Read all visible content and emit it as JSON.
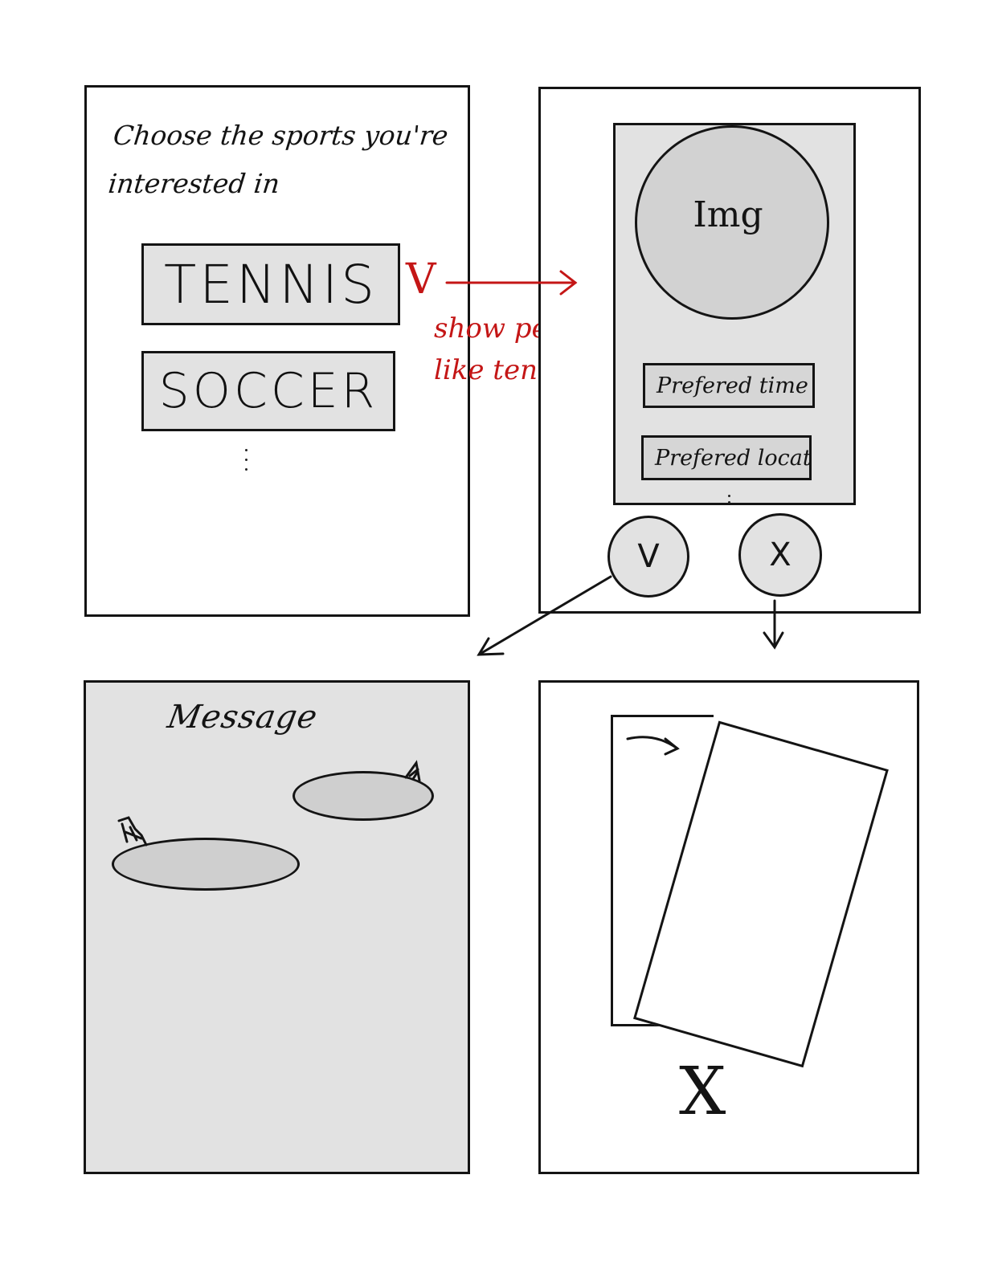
{
  "panel_1": {
    "title": "Choose the sports you're interested in",
    "sports": [
      "TENNIS",
      "SOCCER"
    ]
  },
  "annotation": {
    "check_mark": "V",
    "note": "show people like tennis"
  },
  "panel_2": {
    "image_label": "Img",
    "preferred_time": "Prefered time",
    "preferred_location": "Prefered location",
    "accept_label": "V",
    "reject_label": "X"
  },
  "panel_3": {
    "title": "Message"
  },
  "panel_4": {
    "reject_mark": "X"
  },
  "colors": {
    "ink": "#141414",
    "annotation_red": "#c41616",
    "fill_gray": "#e2e2e2",
    "circle_gray": "#d2d2d2"
  }
}
